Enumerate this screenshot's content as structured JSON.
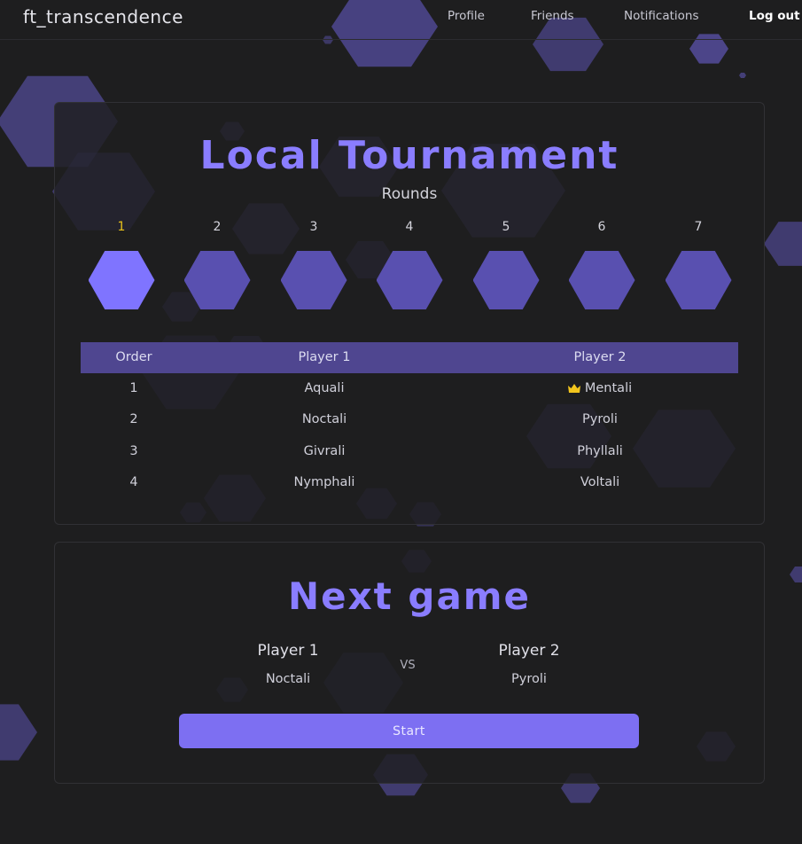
{
  "nav": {
    "brand": "ft_transcendence",
    "links": [
      "Profile",
      "Friends",
      "Notifications",
      "Log out"
    ]
  },
  "tournament": {
    "title": "Local Tournament",
    "rounds_label": "Rounds",
    "rounds": [
      "1",
      "2",
      "3",
      "4",
      "5",
      "6",
      "7"
    ],
    "active_round": "1",
    "columns": [
      "Order",
      "Player 1",
      "Player 2"
    ],
    "matches": [
      {
        "order": "1",
        "player1": "Aquali",
        "player2": "Mentali",
        "winner": "player2"
      },
      {
        "order": "2",
        "player1": "Noctali",
        "player2": "Pyroli",
        "winner": ""
      },
      {
        "order": "3",
        "player1": "Givrali",
        "player2": "Phyllali",
        "winner": ""
      },
      {
        "order": "4",
        "player1": "Nymphali",
        "player2": "Voltali",
        "winner": ""
      }
    ]
  },
  "next_game": {
    "title": "Next game",
    "player1_label": "Player 1",
    "player1_name": "Noctali",
    "vs": "VS",
    "player2_label": "Player 2",
    "player2_name": "Pyroli",
    "start_label": "Start"
  },
  "colors": {
    "background": "#1e1e1f",
    "accent": "#8a7dff",
    "hex_inactive": "#5950b0",
    "hex_active": "#7f74ff",
    "table_header": "#4f4690",
    "active_round_label": "#e9c21a",
    "button": "#7d6ff2"
  },
  "icons": {
    "winner": "crown-icon"
  }
}
